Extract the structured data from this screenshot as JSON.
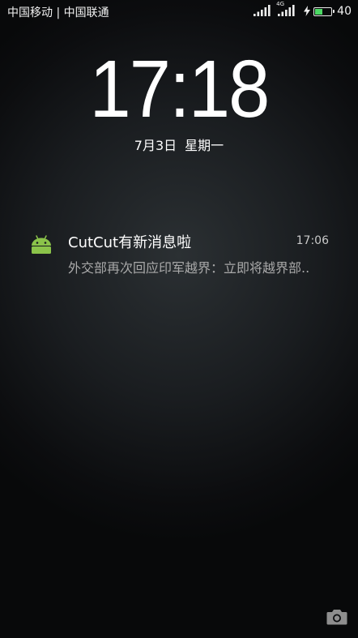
{
  "status_bar": {
    "carrier_text": "中国移动 | 中国联通",
    "network_type": "4G",
    "battery_percent": "40",
    "battery_level": 0.4
  },
  "lockscreen": {
    "time": "17:18",
    "date": "7月3日",
    "weekday": "星期一"
  },
  "notification": {
    "app_icon": "android-icon",
    "title": "CutCut有新消息啦",
    "time": "17:06",
    "body": "外交部再次回应印军越界：立即将越界部.."
  },
  "camera_shortcut": {
    "icon": "camera-icon"
  },
  "colors": {
    "android_green": "#8bc34a",
    "battery_fill": "#4cd964",
    "text_secondary": "#a9a9a9"
  }
}
